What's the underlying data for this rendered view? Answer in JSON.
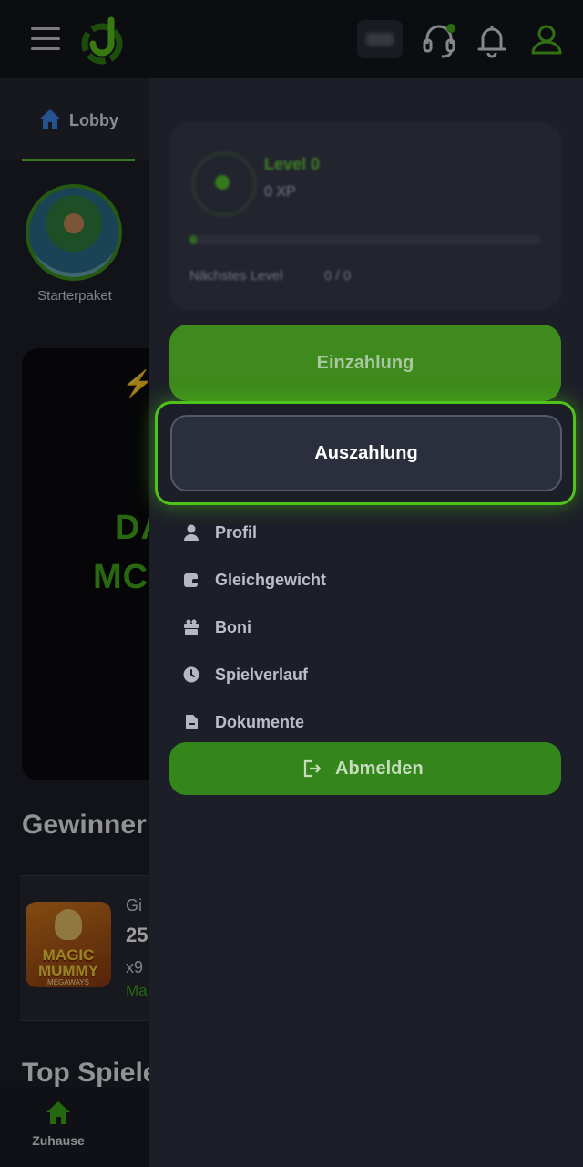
{
  "header": {
    "menu_icon": "hamburger-icon",
    "logo_icon": "brand-logo",
    "support_icon": "headset-icon",
    "notifications_icon": "bell-icon",
    "profile_icon": "user-icon"
  },
  "tabs": [
    {
      "label": "Lobby",
      "icon": "home-icon"
    }
  ],
  "promo": {
    "label": "Starterpaket"
  },
  "banner": {
    "line1": "DA",
    "line2": "MC"
  },
  "sections": {
    "winners_title": "Gewinner",
    "top_games_title": "Top Spiele"
  },
  "winner_card": {
    "user": "Gi",
    "amount": "25",
    "multiplier": "x9",
    "game_link": "Ma",
    "game_title": "MAGIC MUMMY",
    "game_subtitle": "MEGAWAYS"
  },
  "drawer": {
    "level": {
      "name": "Level 0",
      "points": "0 XP",
      "next_label": "Nächstes Level",
      "next_value": "0 / 0",
      "progress": 0.02
    },
    "deposit_label": "Einzahlung",
    "withdraw_label": "Auszahlung",
    "menu": [
      {
        "label": "Profil",
        "icon": "user-icon"
      },
      {
        "label": "Gleichgewicht",
        "icon": "wallet-icon"
      },
      {
        "label": "Boni",
        "icon": "gift-icon"
      },
      {
        "label": "Spielverlauf",
        "icon": "clock-icon"
      },
      {
        "label": "Dokumente",
        "icon": "document-icon"
      }
    ],
    "logout_label": "Abmelden"
  },
  "bottom_nav": {
    "home_label": "Zuhause"
  },
  "chat_icon": "chat-bubble-icon",
  "colors": {
    "accent": "#4fc21b",
    "button_green": "#3e8a1c",
    "background": "#1d1f28"
  }
}
